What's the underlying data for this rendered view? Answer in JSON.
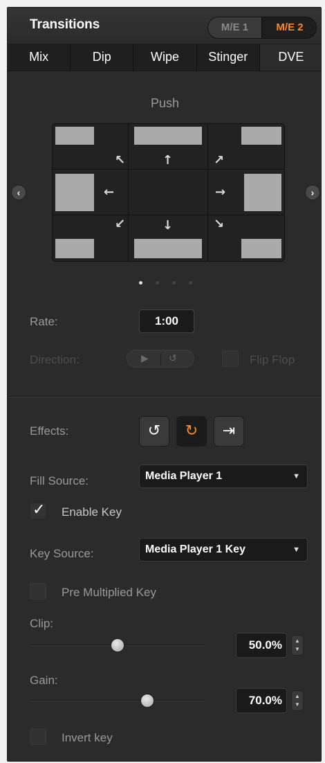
{
  "header": {
    "title": "Transitions",
    "me1": "M/E 1",
    "me2": "M/E 2"
  },
  "tabs": [
    {
      "label": "Mix"
    },
    {
      "label": "Dip"
    },
    {
      "label": "Wipe"
    },
    {
      "label": "Stinger"
    },
    {
      "label": "DVE"
    }
  ],
  "dve": {
    "effect_name": "Push",
    "page_count": 4,
    "current_page": 1
  },
  "rate": {
    "label": "Rate:",
    "value": "1:00"
  },
  "direction": {
    "label": "Direction:",
    "flipflop_label": "Flip Flop"
  },
  "effects": {
    "label": "Effects:"
  },
  "fill_source": {
    "label": "Fill Source:",
    "value": "Media Player 1"
  },
  "enable_key": {
    "label": "Enable Key",
    "checked": true
  },
  "key_source": {
    "label": "Key Source:",
    "value": "Media Player 1 Key"
  },
  "pre_multiplied": {
    "label": "Pre Multiplied Key",
    "checked": false
  },
  "clip": {
    "label": "Clip:",
    "value": "50.0%",
    "level": 0.5
  },
  "gain": {
    "label": "Gain:",
    "value": "70.0%",
    "level": 0.7
  },
  "invert_key": {
    "label": "Invert key",
    "checked": false
  },
  "colors": {
    "accent": "#ff8a1d",
    "panel": "#2b2b2b",
    "field": "#1a1a1a"
  }
}
